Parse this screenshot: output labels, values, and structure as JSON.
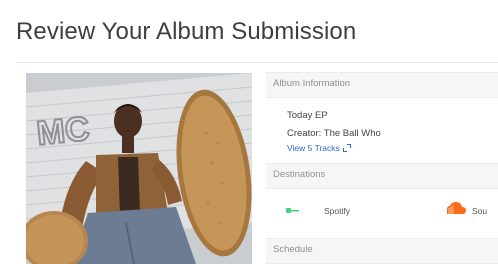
{
  "header": {
    "title": "Review Your Album Submission"
  },
  "album_info": {
    "section_label": "Album Information",
    "name": "Today EP",
    "creator": "Creator: The Ball Who",
    "view_tracks": "View 5 Tracks"
  },
  "destinations": {
    "section_label": "Destinations",
    "items": [
      {
        "label": "Spotify",
        "icon": "spotify-icon",
        "color": "#4bd07a"
      },
      {
        "label": "Sou",
        "icon": "soundcloud-icon",
        "color": "#ff6a1a"
      }
    ]
  },
  "schedule": {
    "section_label": "Schedule"
  },
  "colors": {
    "link": "#2f6fc0",
    "section_bg": "#f6f6f6",
    "title": "#3f3f3f"
  }
}
